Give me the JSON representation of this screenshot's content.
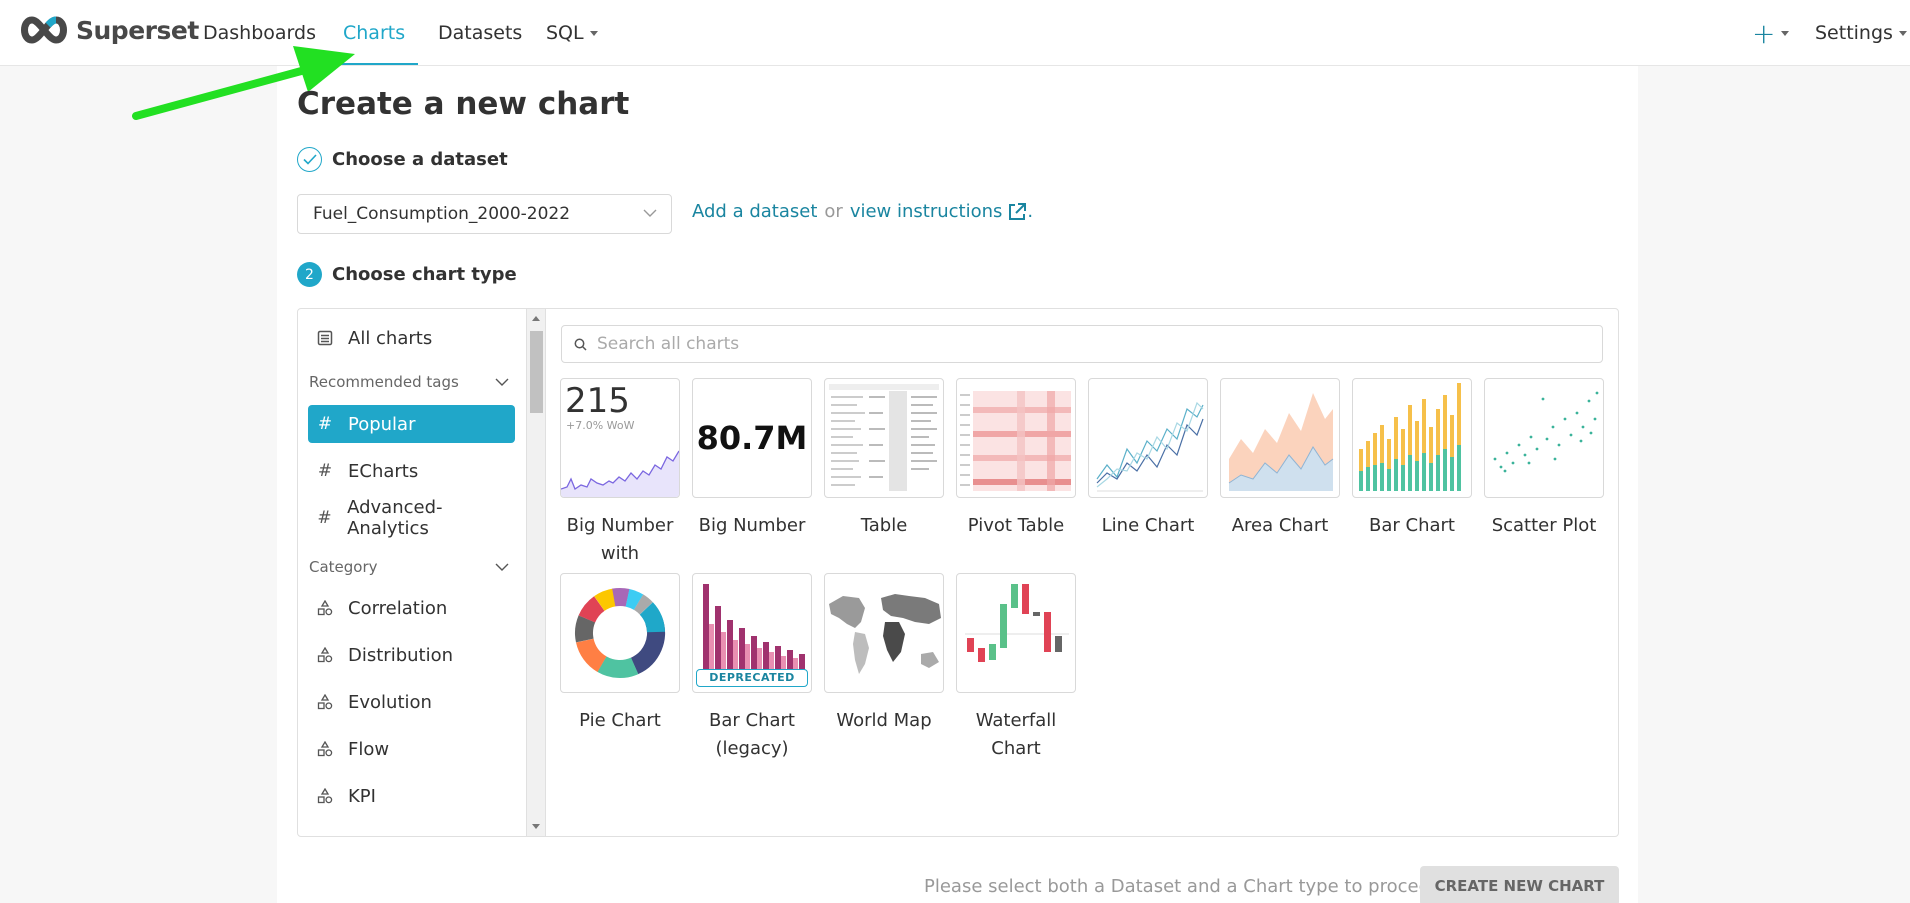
{
  "navbar": {
    "brand": "Superset",
    "items": [
      "Dashboards",
      "Charts",
      "Datasets",
      "SQL"
    ],
    "settings": "Settings"
  },
  "page": {
    "title": "Create a new chart",
    "step1": "Choose a dataset",
    "step2_num": "2",
    "step2": "Choose chart type"
  },
  "dataset": {
    "selected": "Fuel_Consumption_2000-2022",
    "add_link": "Add a dataset",
    "or": "or",
    "instructions_link": "view instructions",
    "period": "."
  },
  "sidebar": {
    "all_charts": "All charts",
    "recommended_tags": "Recommended tags",
    "tags": [
      "Popular",
      "ECharts",
      "Advanced-Analytics"
    ],
    "category": "Category",
    "categories": [
      "Correlation",
      "Distribution",
      "Evolution",
      "Flow",
      "KPI"
    ]
  },
  "search": {
    "placeholder": "Search all charts"
  },
  "charts": [
    {
      "label": "Big Number with Trendline",
      "value": "215",
      "sub": "+7.0% WoW"
    },
    {
      "label": "Big Number",
      "value": "80.7M"
    },
    {
      "label": "Table"
    },
    {
      "label": "Pivot Table"
    },
    {
      "label": "Line Chart"
    },
    {
      "label": "Area Chart"
    },
    {
      "label": "Bar Chart"
    },
    {
      "label": "Scatter Plot"
    },
    {
      "label": "Pie Chart"
    },
    {
      "label": "Bar Chart (legacy)",
      "badge": "DEPRECATED"
    },
    {
      "label": "World Map"
    },
    {
      "label": "Waterfall Chart"
    }
  ],
  "footer": {
    "hint": "Please select both a Dataset and a Chart type to proceed",
    "button": "CREATE NEW CHART"
  },
  "colors": {
    "accent": "#20a7c9",
    "link": "#1a85a0",
    "annotation_arrow": "#22e022"
  }
}
